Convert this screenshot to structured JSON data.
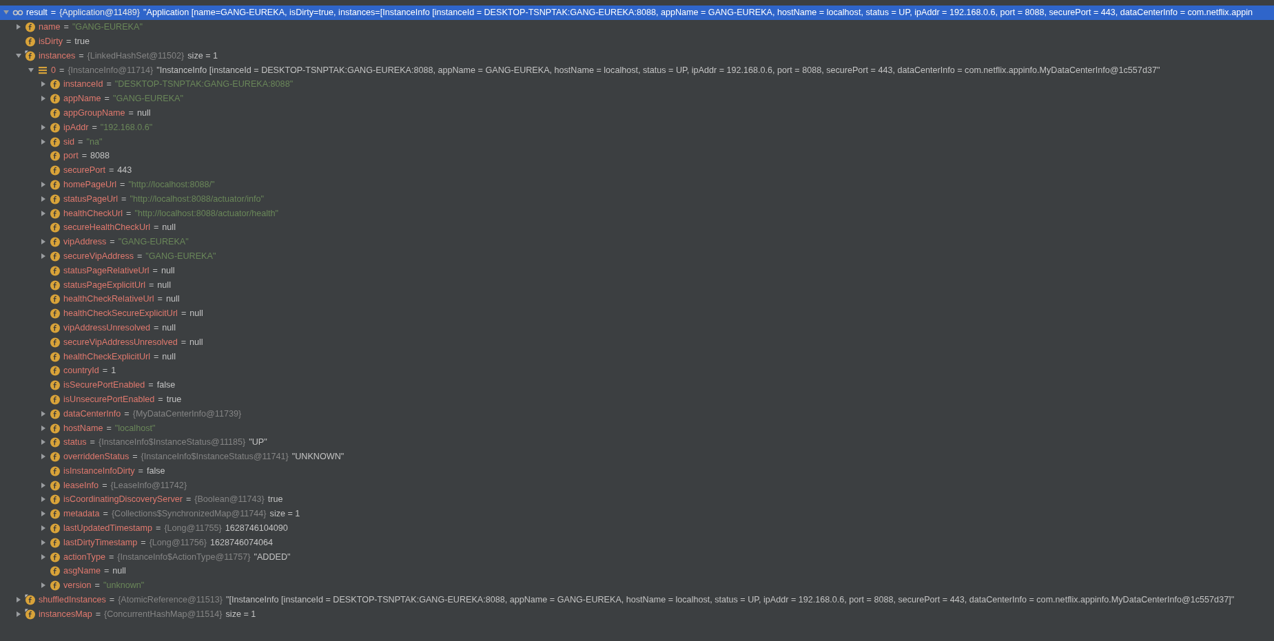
{
  "variables": [
    {
      "name": "result",
      "kind": "watch",
      "sep": "=",
      "expanded": true,
      "selected": true,
      "ref": "{Application@11489}",
      "value": "\"Application [name=GANG-EUREKA, isDirty=true, instances=[InstanceInfo [instanceId = DESKTOP-TSNPTAK:GANG-EUREKA:8088, appName = GANG-EUREKA, hostName = localhost, status = UP, ipAddr = 192.168.0.6, port = 8088, securePort = 443, dataCenterInfo = com.netflix.appin",
      "children": [
        {
          "name": "name",
          "kind": "field",
          "sep": "=",
          "expanded": false,
          "selected": false,
          "string_value": "\"GANG-EUREKA\""
        },
        {
          "name": "isDirty",
          "kind": "field",
          "sep": "=",
          "selected": false,
          "value": "true"
        },
        {
          "name": "instances",
          "kind": "field-marked",
          "sep": "=",
          "expanded": true,
          "selected": false,
          "ref": "{LinkedHashSet@11502}",
          "value": "size = 1",
          "children": [
            {
              "name": "0",
              "kind": "element",
              "sep": "=",
              "expanded": true,
              "selected": false,
              "ref": "{InstanceInfo@11714}",
              "value": "\"InstanceInfo [instanceId = DESKTOP-TSNPTAK:GANG-EUREKA:8088, appName = GANG-EUREKA, hostName = localhost, status = UP, ipAddr = 192.168.0.6, port = 8088, securePort = 443, dataCenterInfo = com.netflix.appinfo.MyDataCenterInfo@1c557d37\"",
              "children": [
                {
                  "name": "instanceId",
                  "kind": "field",
                  "sep": "=",
                  "expanded": false,
                  "selected": false,
                  "string_value": "\"DESKTOP-TSNPTAK:GANG-EUREKA:8088\""
                },
                {
                  "name": "appName",
                  "kind": "field",
                  "sep": "=",
                  "expanded": false,
                  "selected": false,
                  "string_value": "\"GANG-EUREKA\""
                },
                {
                  "name": "appGroupName",
                  "kind": "field",
                  "sep": "=",
                  "selected": false,
                  "value": "null"
                },
                {
                  "name": "ipAddr",
                  "kind": "field",
                  "sep": "=",
                  "expanded": false,
                  "selected": false,
                  "string_value": "\"192.168.0.6\""
                },
                {
                  "name": "sid",
                  "kind": "field",
                  "sep": "=",
                  "expanded": false,
                  "selected": false,
                  "string_value": "\"na\""
                },
                {
                  "name": "port",
                  "kind": "field",
                  "sep": "=",
                  "selected": false,
                  "value": "8088"
                },
                {
                  "name": "securePort",
                  "kind": "field",
                  "sep": "=",
                  "selected": false,
                  "value": "443"
                },
                {
                  "name": "homePageUrl",
                  "kind": "field",
                  "sep": "=",
                  "expanded": false,
                  "selected": false,
                  "string_value": "\"http://localhost:8088/\""
                },
                {
                  "name": "statusPageUrl",
                  "kind": "field",
                  "sep": "=",
                  "expanded": false,
                  "selected": false,
                  "string_value": "\"http://localhost:8088/actuator/info\""
                },
                {
                  "name": "healthCheckUrl",
                  "kind": "field",
                  "sep": "=",
                  "expanded": false,
                  "selected": false,
                  "string_value": "\"http://localhost:8088/actuator/health\""
                },
                {
                  "name": "secureHealthCheckUrl",
                  "kind": "field",
                  "sep": "=",
                  "selected": false,
                  "value": "null"
                },
                {
                  "name": "vipAddress",
                  "kind": "field",
                  "sep": "=",
                  "expanded": false,
                  "selected": false,
                  "string_value": "\"GANG-EUREKA\""
                },
                {
                  "name": "secureVipAddress",
                  "kind": "field",
                  "sep": "=",
                  "expanded": false,
                  "selected": false,
                  "string_value": "\"GANG-EUREKA\""
                },
                {
                  "name": "statusPageRelativeUrl",
                  "kind": "field",
                  "sep": "=",
                  "selected": false,
                  "value": "null"
                },
                {
                  "name": "statusPageExplicitUrl",
                  "kind": "field",
                  "sep": "=",
                  "selected": false,
                  "value": "null"
                },
                {
                  "name": "healthCheckRelativeUrl",
                  "kind": "field",
                  "sep": "=",
                  "selected": false,
                  "value": "null"
                },
                {
                  "name": "healthCheckSecureExplicitUrl",
                  "kind": "field",
                  "sep": "=",
                  "selected": false,
                  "value": "null"
                },
                {
                  "name": "vipAddressUnresolved",
                  "kind": "field",
                  "sep": "=",
                  "selected": false,
                  "value": "null"
                },
                {
                  "name": "secureVipAddressUnresolved",
                  "kind": "field",
                  "sep": "=",
                  "selected": false,
                  "value": "null"
                },
                {
                  "name": "healthCheckExplicitUrl",
                  "kind": "field",
                  "sep": "=",
                  "selected": false,
                  "value": "null"
                },
                {
                  "name": "countryId",
                  "kind": "field",
                  "sep": "=",
                  "selected": false,
                  "value": "1"
                },
                {
                  "name": "isSecurePortEnabled",
                  "kind": "field",
                  "sep": "=",
                  "selected": false,
                  "value": "false"
                },
                {
                  "name": "isUnsecurePortEnabled",
                  "kind": "field",
                  "sep": "=",
                  "selected": false,
                  "value": "true"
                },
                {
                  "name": "dataCenterInfo",
                  "kind": "field",
                  "sep": "=",
                  "expanded": false,
                  "selected": false,
                  "ref": "{MyDataCenterInfo@11739}"
                },
                {
                  "name": "hostName",
                  "kind": "field",
                  "sep": "=",
                  "expanded": false,
                  "selected": false,
                  "string_value": "\"localhost\""
                },
                {
                  "name": "status",
                  "kind": "field",
                  "sep": "=",
                  "expanded": false,
                  "selected": false,
                  "ref": "{InstanceInfo$InstanceStatus@11185}",
                  "value": "\"UP\""
                },
                {
                  "name": "overriddenStatus",
                  "kind": "field",
                  "sep": "=",
                  "expanded": false,
                  "selected": false,
                  "ref": "{InstanceInfo$InstanceStatus@11741}",
                  "value": "\"UNKNOWN\""
                },
                {
                  "name": "isInstanceInfoDirty",
                  "kind": "field",
                  "sep": "=",
                  "selected": false,
                  "value": "false"
                },
                {
                  "name": "leaseInfo",
                  "kind": "field",
                  "sep": "=",
                  "expanded": false,
                  "selected": false,
                  "ref": "{LeaseInfo@11742}"
                },
                {
                  "name": "isCoordinatingDiscoveryServer",
                  "kind": "field",
                  "sep": "=",
                  "expanded": false,
                  "selected": false,
                  "ref": "{Boolean@11743}",
                  "value": "true"
                },
                {
                  "name": "metadata",
                  "kind": "field",
                  "sep": "=",
                  "expanded": false,
                  "selected": false,
                  "ref": "{Collections$SynchronizedMap@11744}",
                  "value": "size = 1"
                },
                {
                  "name": "lastUpdatedTimestamp",
                  "kind": "field",
                  "sep": "=",
                  "expanded": false,
                  "selected": false,
                  "ref": "{Long@11755}",
                  "value": "1628746104090"
                },
                {
                  "name": "lastDirtyTimestamp",
                  "kind": "field",
                  "sep": "=",
                  "expanded": false,
                  "selected": false,
                  "ref": "{Long@11756}",
                  "value": "1628746074064"
                },
                {
                  "name": "actionType",
                  "kind": "field",
                  "sep": "=",
                  "expanded": false,
                  "selected": false,
                  "ref": "{InstanceInfo$ActionType@11757}",
                  "value": "\"ADDED\""
                },
                {
                  "name": "asgName",
                  "kind": "field",
                  "sep": "=",
                  "selected": false,
                  "value": "null"
                },
                {
                  "name": "version",
                  "kind": "field",
                  "sep": "=",
                  "expanded": false,
                  "selected": false,
                  "string_value": "\"unknown\""
                }
              ]
            }
          ]
        },
        {
          "name": "shuffledInstances",
          "kind": "field-marked",
          "sep": "=",
          "expanded": false,
          "selected": false,
          "ref": "{AtomicReference@11513}",
          "value": "\"[InstanceInfo [instanceId = DESKTOP-TSNPTAK:GANG-EUREKA:8088, appName = GANG-EUREKA, hostName = localhost, status = UP, ipAddr = 192.168.0.6, port = 8088, securePort = 443, dataCenterInfo = com.netflix.appinfo.MyDataCenterInfo@1c557d37]\""
        },
        {
          "name": "instancesMap",
          "kind": "field-marked",
          "sep": "=",
          "expanded": false,
          "selected": false,
          "ref": "{ConcurrentHashMap@11514}",
          "value": "size = 1"
        }
      ]
    }
  ]
}
